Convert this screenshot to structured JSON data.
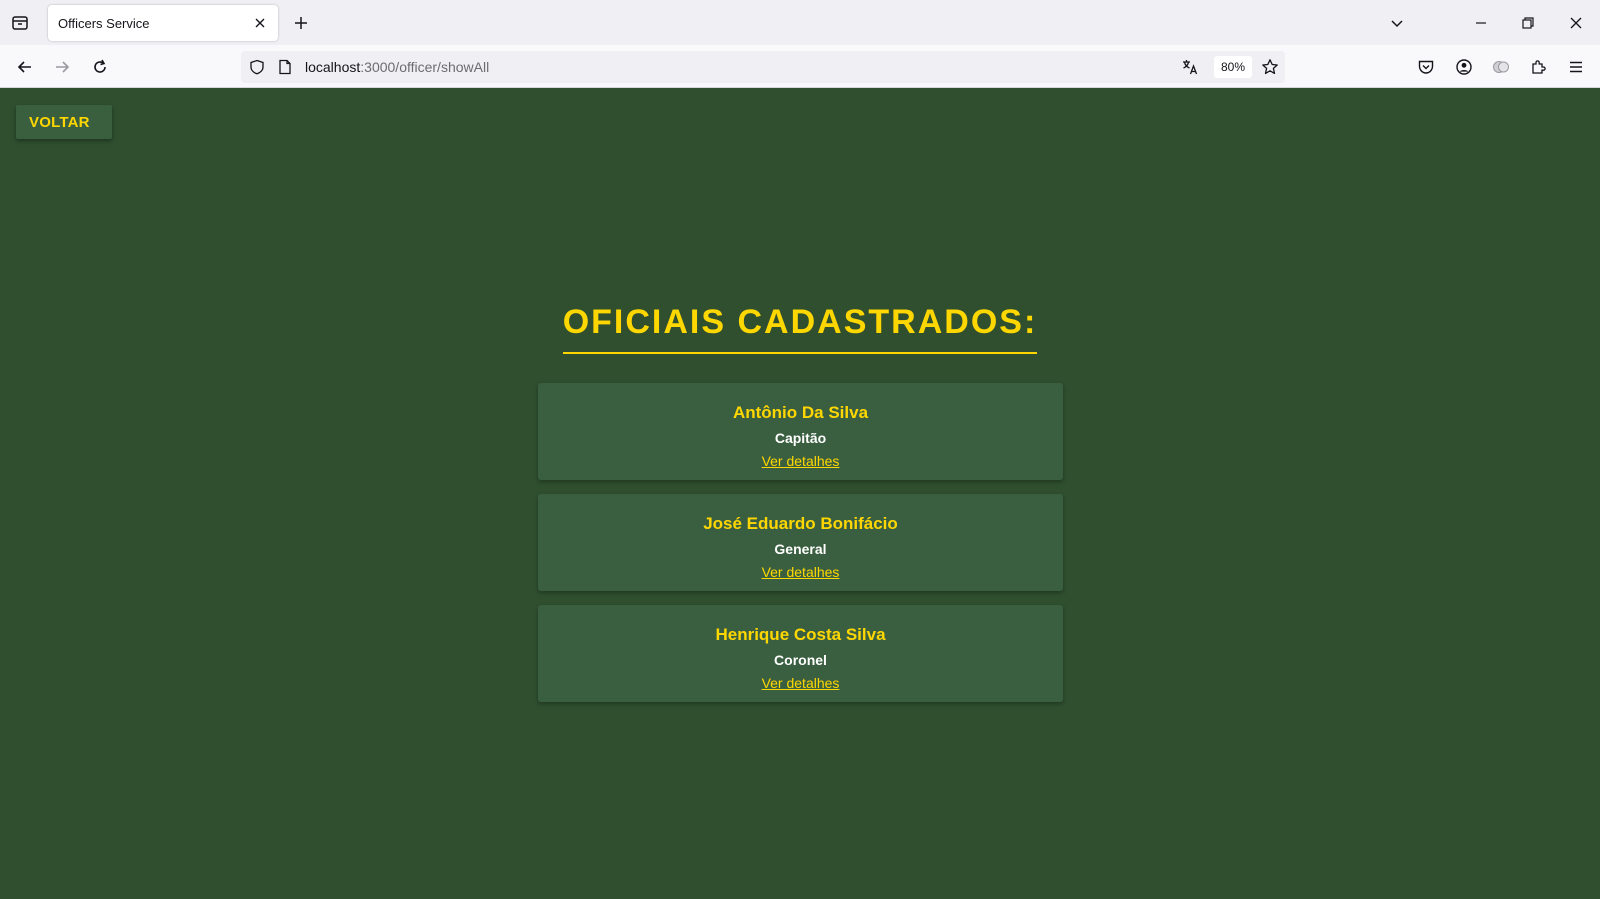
{
  "browser": {
    "tab_title": "Officers Service",
    "url_host": "localhost",
    "url_path": ":3000/officer/showAll",
    "zoom": "80%"
  },
  "page": {
    "back_button": "VOLTAR",
    "heading": "OFICIAIS CADASTRADOS:",
    "officers": [
      {
        "name": "Antônio Da Silva",
        "rank": "Capitão",
        "link": "Ver detalhes"
      },
      {
        "name": "José Eduardo Bonifácio",
        "rank": "General",
        "link": "Ver detalhes"
      },
      {
        "name": "Henrique Costa Silva",
        "rank": "Coronel",
        "link": "Ver detalhes"
      }
    ]
  },
  "colors": {
    "background": "#2f4f2f",
    "card": "#3a5f40",
    "accent": "#ffd700"
  }
}
